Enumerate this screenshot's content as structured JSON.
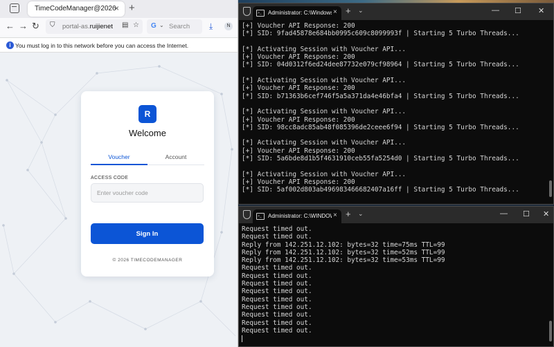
{
  "browser": {
    "tab_title": "TimeCodeManager@2026",
    "url_prefix": "portal-as.",
    "url_domain": "ruijienet",
    "search_placeholder": "Search",
    "avatar_letter": "N",
    "notice": "You must log in to this network before you can access the Internet."
  },
  "login": {
    "logo_letter": "R",
    "welcome": "Welcome",
    "tab_voucher": "Voucher",
    "tab_account": "Account",
    "access_code_label": "ACCESS CODE",
    "voucher_placeholder": "Enter voucher code",
    "sign_in": "Sign In",
    "footer": "© 2026 TIMECODEMANAGER",
    "accent_color": "#0c55d6"
  },
  "terminal1": {
    "title": "Administrator: C:\\Windows\\S",
    "lines": [
      "[+] Voucher API Response: 200",
      "[*] SID: 9fad45878e684bb0995c609c8099993f | Starting 5 Turbo Threads...",
      "",
      "[*] Activating Session with Voucher API...",
      "[+] Voucher API Response: 200",
      "[*] SID: 04d0312f6ed24dee87732e079cf98964 | Starting 5 Turbo Threads...",
      "",
      "[*] Activating Session with Voucher API...",
      "[+] Voucher API Response: 200",
      "[*] SID: b71363b6cef746f5a5a371da4e46bfa4 | Starting 5 Turbo Threads...",
      "",
      "[*] Activating Session with Voucher API...",
      "[+] Voucher API Response: 200",
      "[*] SID: 98cc8adc85ab48f085396de2ceee6f94 | Starting 5 Turbo Threads...",
      "",
      "[*] Activating Session with Voucher API...",
      "[+] Voucher API Response: 200",
      "[*] SID: 5a6bde8d1b5f4631910ceb55fa5254d0 | Starting 5 Turbo Threads...",
      "",
      "[*] Activating Session with Voucher API...",
      "[+] Voucher API Response: 200",
      "[*] SID: 5af002d803ab4969834666824​07a16ff | Starting 5 Turbo Threads..."
    ]
  },
  "terminal2": {
    "title": "Administrator: C:\\WINDOWS\\",
    "lines": [
      "Request timed out.",
      "Request timed out.",
      "Reply from 142.251.12.102: bytes=32 time=75ms TTL=99",
      "Reply from 142.251.12.102: bytes=32 time=52ms TTL=99",
      "Reply from 142.251.12.102: bytes=32 time=53ms TTL=99",
      "Request timed out.",
      "Request timed out.",
      "Request timed out.",
      "Request timed out.",
      "Request timed out.",
      "Request timed out.",
      "Request timed out.",
      "Request timed out.",
      "Request timed out."
    ]
  }
}
